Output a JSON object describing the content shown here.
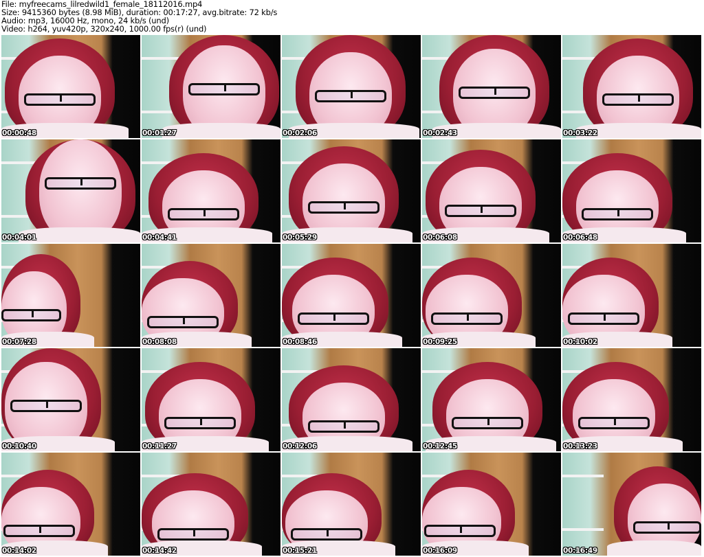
{
  "header": {
    "file": "File: myfreecams_lilredwild1_female_18112016.mp4",
    "size": "Size: 9415360 bytes (8.98 MiB), duration: 00:17:27, avg.bitrate: 72 kb/s",
    "audio": "Audio: mp3, 16000 Hz, mono, 24 kb/s (und)",
    "video": "Video: h264, yuv420p, 320x240, 1000.00 fps(r) (und)"
  },
  "thumbnails": [
    {
      "timestamp": "00:00:48"
    },
    {
      "timestamp": "00:01:27"
    },
    {
      "timestamp": "00:02:06"
    },
    {
      "timestamp": "00:02:43"
    },
    {
      "timestamp": "00:03:22"
    },
    {
      "timestamp": "00:04:01"
    },
    {
      "timestamp": "00:04:41"
    },
    {
      "timestamp": "00:05:29"
    },
    {
      "timestamp": "00:06:08"
    },
    {
      "timestamp": "00:06:48"
    },
    {
      "timestamp": "00:07:28"
    },
    {
      "timestamp": "00:08:08"
    },
    {
      "timestamp": "00:08:46"
    },
    {
      "timestamp": "00:09:25"
    },
    {
      "timestamp": "00:10:02"
    },
    {
      "timestamp": "00:10:40"
    },
    {
      "timestamp": "00:11:27"
    },
    {
      "timestamp": "00:12:06"
    },
    {
      "timestamp": "00:12:45"
    },
    {
      "timestamp": "00:13:23"
    },
    {
      "timestamp": "00:14:02"
    },
    {
      "timestamp": "00:14:42"
    },
    {
      "timestamp": "00:15:21"
    },
    {
      "timestamp": "00:16:09"
    },
    {
      "timestamp": "00:16:49"
    }
  ]
}
